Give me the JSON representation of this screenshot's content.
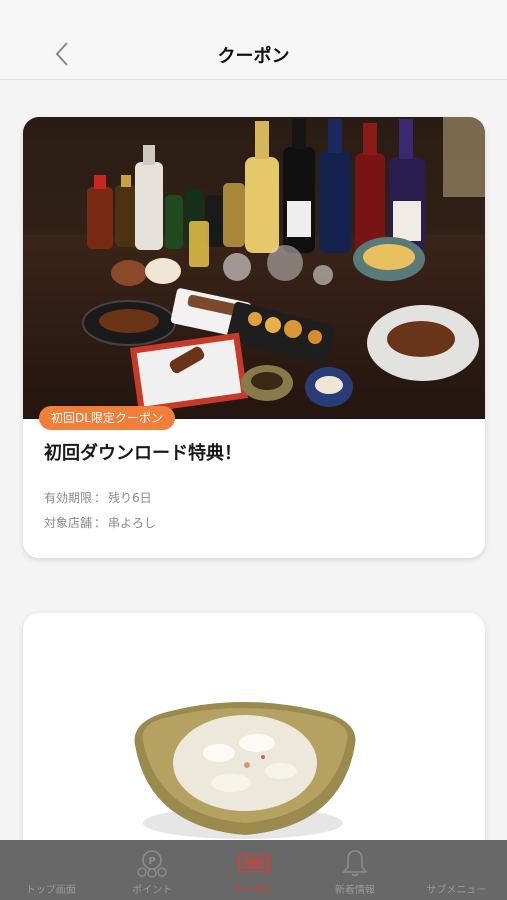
{
  "header": {
    "title": "クーポン"
  },
  "coupons": [
    {
      "badge": "初回DL限定クーポン",
      "title": "初回ダウンロード特典！",
      "expiry_label": "有効期限",
      "expiry_value": "残り6日",
      "store_label": "対象店舗",
      "store_value": "串よろし"
    }
  ],
  "tabbar": {
    "items": [
      {
        "label": "トップ画面",
        "icon": "home-icon"
      },
      {
        "label": "ポイント",
        "icon": "points-icon"
      },
      {
        "label": "クーポン",
        "icon": "coupon-icon",
        "active": true
      },
      {
        "label": "新着情報",
        "icon": "bell-icon"
      },
      {
        "label": "サブメニュー",
        "icon": "menu-icon"
      }
    ]
  },
  "colors": {
    "accent": "#e23a2e",
    "badge": "#ef7f3a",
    "tabbar_bg": "#686868"
  }
}
